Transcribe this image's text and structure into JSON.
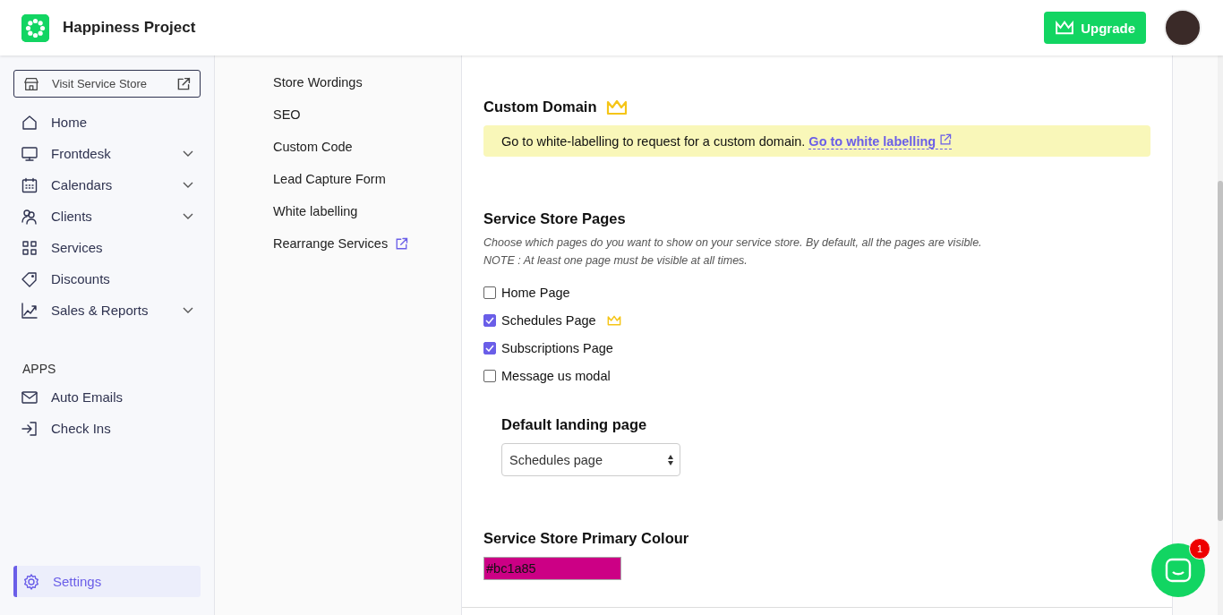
{
  "header": {
    "brand": "Happiness Project",
    "upgrade_button": "Upgrade"
  },
  "sidebar": {
    "visit_button": "Visit Service Store",
    "items": [
      {
        "kind": "home",
        "label": "Home",
        "expandable": false,
        "selected": false
      },
      {
        "kind": "monitor",
        "label": "Frontdesk",
        "expandable": true,
        "selected": false
      },
      {
        "kind": "calendar",
        "label": "Calendars",
        "expandable": true,
        "selected": false
      },
      {
        "kind": "users",
        "label": "Clients",
        "expandable": true,
        "selected": false
      },
      {
        "kind": "grid",
        "label": "Services",
        "expandable": false,
        "selected": false
      },
      {
        "kind": "tag",
        "label": "Discounts",
        "expandable": false,
        "selected": false
      },
      {
        "kind": "chart",
        "label": "Sales & Reports",
        "expandable": true,
        "selected": false
      }
    ],
    "apps_heading": "APPS",
    "apps": [
      {
        "kind": "mail",
        "label": "Auto Emails",
        "selected": false
      },
      {
        "kind": "login",
        "label": "Check Ins",
        "selected": false
      }
    ],
    "bottom": [
      {
        "kind": "gear",
        "label": "Settings",
        "selected": true
      }
    ]
  },
  "settings_nav": [
    {
      "label": "Store Wordings",
      "external": false
    },
    {
      "label": "SEO",
      "external": false
    },
    {
      "label": "Custom Code",
      "external": false
    },
    {
      "label": "Lead Capture Form",
      "external": false
    },
    {
      "label": "White labelling",
      "external": false
    },
    {
      "label": "Rearrange Services",
      "external": true
    }
  ],
  "custom_domain": {
    "title": "Custom Domain",
    "premium": true,
    "notice": "Go to white-labelling to request for a custom domain.",
    "link": "Go to white labelling"
  },
  "store_pages": {
    "title": "Service Store Pages",
    "description": "Choose which pages do you want to show on your service store. By default, all the pages are visible.",
    "note": "NOTE : At least one page must be visible at all times.",
    "pages": [
      {
        "label": "Home Page",
        "checked": false,
        "premium": false
      },
      {
        "label": "Schedules Page",
        "checked": true,
        "premium": true
      },
      {
        "label": "Subscriptions Page",
        "checked": true,
        "premium": false
      },
      {
        "label": "Message us modal",
        "checked": false,
        "premium": false
      }
    ],
    "landing_label": "Default landing page",
    "landing_value": "Schedules page"
  },
  "primary_colour": {
    "title": "Service Store Primary Colour",
    "value": "#bc1a85",
    "color": "#cc0085"
  },
  "chat": {
    "badge": "1"
  }
}
